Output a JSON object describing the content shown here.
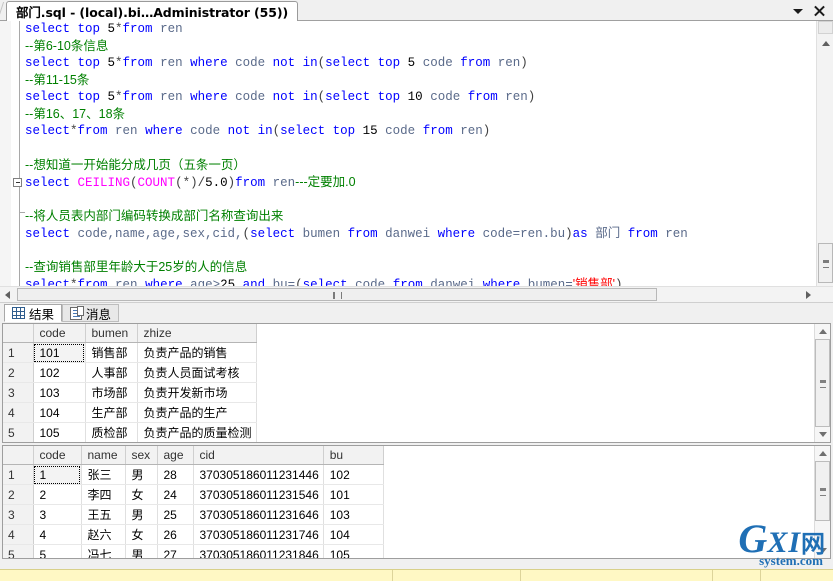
{
  "window": {
    "tab_title": "部门.sql - (local).bi…Administrator (55))",
    "dropdown_icon": "chevron-down-icon",
    "close_icon": "close-icon"
  },
  "editor": {
    "lines": [
      [
        {
          "t": "select top ",
          "c": "kw"
        },
        {
          "t": "5",
          "c": "num"
        },
        {
          "t": "*",
          "c": "pl"
        },
        {
          "t": "from ",
          "c": "kw"
        },
        {
          "t": "ren",
          "c": "id"
        }
      ],
      [
        {
          "t": "--第6-10条信息",
          "c": "cmt"
        }
      ],
      [
        {
          "t": "select top ",
          "c": "kw"
        },
        {
          "t": "5",
          "c": "num"
        },
        {
          "t": "*",
          "c": "pl"
        },
        {
          "t": "from ",
          "c": "kw"
        },
        {
          "t": "ren ",
          "c": "id"
        },
        {
          "t": "where ",
          "c": "kw"
        },
        {
          "t": "code ",
          "c": "id"
        },
        {
          "t": "not ",
          "c": "kw"
        },
        {
          "t": "in",
          "c": "kw"
        },
        {
          "t": "(",
          "c": "pl"
        },
        {
          "t": "select top ",
          "c": "kw"
        },
        {
          "t": "5 ",
          "c": "num"
        },
        {
          "t": "code ",
          "c": "id"
        },
        {
          "t": "from ",
          "c": "kw"
        },
        {
          "t": "ren",
          "c": "id"
        },
        {
          "t": ")",
          "c": "pl"
        }
      ],
      [
        {
          "t": "--第11-15条",
          "c": "cmt"
        }
      ],
      [
        {
          "t": "select top ",
          "c": "kw"
        },
        {
          "t": "5",
          "c": "num"
        },
        {
          "t": "*",
          "c": "pl"
        },
        {
          "t": "from ",
          "c": "kw"
        },
        {
          "t": "ren ",
          "c": "id"
        },
        {
          "t": "where ",
          "c": "kw"
        },
        {
          "t": "code ",
          "c": "id"
        },
        {
          "t": "not ",
          "c": "kw"
        },
        {
          "t": "in",
          "c": "kw"
        },
        {
          "t": "(",
          "c": "pl"
        },
        {
          "t": "select top ",
          "c": "kw"
        },
        {
          "t": "10 ",
          "c": "num"
        },
        {
          "t": "code ",
          "c": "id"
        },
        {
          "t": "from ",
          "c": "kw"
        },
        {
          "t": "ren",
          "c": "id"
        },
        {
          "t": ")",
          "c": "pl"
        }
      ],
      [
        {
          "t": "--第16、17、18条",
          "c": "cmt"
        }
      ],
      [
        {
          "t": "select",
          "c": "kw"
        },
        {
          "t": "*",
          "c": "pl"
        },
        {
          "t": "from ",
          "c": "kw"
        },
        {
          "t": "ren ",
          "c": "id"
        },
        {
          "t": "where ",
          "c": "kw"
        },
        {
          "t": "code ",
          "c": "id"
        },
        {
          "t": "not ",
          "c": "kw"
        },
        {
          "t": "in",
          "c": "kw"
        },
        {
          "t": "(",
          "c": "pl"
        },
        {
          "t": "select top ",
          "c": "kw"
        },
        {
          "t": "15 ",
          "c": "num"
        },
        {
          "t": "code ",
          "c": "id"
        },
        {
          "t": "from ",
          "c": "kw"
        },
        {
          "t": "ren",
          "c": "id"
        },
        {
          "t": ")",
          "c": "pl"
        }
      ],
      [],
      [
        {
          "t": "--想知道一开始能分成几页（五条一页）",
          "c": "cmt"
        }
      ],
      [
        {
          "t": "select ",
          "c": "kw"
        },
        {
          "t": "CEILING",
          "c": "fn"
        },
        {
          "t": "(",
          "c": "pl"
        },
        {
          "t": "COUNT",
          "c": "fn"
        },
        {
          "t": "(*)",
          "c": "pl"
        },
        {
          "t": "/",
          "c": "pl"
        },
        {
          "t": "5.0",
          "c": "num"
        },
        {
          "t": ")",
          "c": "pl"
        },
        {
          "t": "from ",
          "c": "kw"
        },
        {
          "t": "ren",
          "c": "id"
        },
        {
          "t": "---定要加.0",
          "c": "cmt"
        }
      ],
      [],
      [
        {
          "t": "--将人员表内部门编码转换成部门名称查询出来",
          "c": "cmt"
        }
      ],
      [
        {
          "t": "select ",
          "c": "kw"
        },
        {
          "t": "code,name,age,sex,cid,",
          "c": "id"
        },
        {
          "t": "(",
          "c": "pl"
        },
        {
          "t": "select ",
          "c": "kw"
        },
        {
          "t": "bumen ",
          "c": "id"
        },
        {
          "t": "from ",
          "c": "kw"
        },
        {
          "t": "danwei ",
          "c": "id"
        },
        {
          "t": "where ",
          "c": "kw"
        },
        {
          "t": "code=ren.bu",
          "c": "id"
        },
        {
          "t": ")",
          "c": "pl"
        },
        {
          "t": "as ",
          "c": "kw"
        },
        {
          "t": "部门",
          "c": "id cn"
        },
        {
          "t": " from ",
          "c": "kw"
        },
        {
          "t": "ren",
          "c": "id"
        }
      ],
      [],
      [
        {
          "t": "--查询销售部里年龄大于25岁的人的信息",
          "c": "cmt"
        }
      ],
      [
        {
          "t": "select",
          "c": "kw"
        },
        {
          "t": "*",
          "c": "pl"
        },
        {
          "t": "from ",
          "c": "kw"
        },
        {
          "t": "ren ",
          "c": "id"
        },
        {
          "t": "where ",
          "c": "kw"
        },
        {
          "t": "age>",
          "c": "id"
        },
        {
          "t": "25 ",
          "c": "num"
        },
        {
          "t": "and ",
          "c": "kw"
        },
        {
          "t": "bu=",
          "c": "id"
        },
        {
          "t": "(",
          "c": "pl"
        },
        {
          "t": "select ",
          "c": "kw"
        },
        {
          "t": "code ",
          "c": "id"
        },
        {
          "t": "from ",
          "c": "kw"
        },
        {
          "t": "danwei ",
          "c": "id"
        },
        {
          "t": "where ",
          "c": "kw"
        },
        {
          "t": "bumen=",
          "c": "id"
        },
        {
          "t": "'销售部'",
          "c": "str cn"
        },
        {
          "t": ")",
          "c": "pl"
        }
      ]
    ]
  },
  "results": {
    "tabs": [
      {
        "label": "结果",
        "icon": "grid-icon",
        "active": true
      },
      {
        "label": "消息",
        "icon": "message-icon",
        "active": false
      }
    ],
    "grid1": {
      "columns": [
        "",
        "code",
        "bumen",
        "zhize"
      ],
      "rows": [
        {
          "n": "1",
          "code": "101",
          "bumen": "销售部",
          "zhize": "负责产品的销售"
        },
        {
          "n": "2",
          "code": "102",
          "bumen": "人事部",
          "zhize": "负责人员面试考核"
        },
        {
          "n": "3",
          "code": "103",
          "bumen": "市场部",
          "zhize": "负责开发新市场"
        },
        {
          "n": "4",
          "code": "104",
          "bumen": "生产部",
          "zhize": "负责产品的生产"
        },
        {
          "n": "5",
          "code": "105",
          "bumen": "质检部",
          "zhize": "负责产品的质量检测"
        }
      ]
    },
    "grid2": {
      "columns": [
        "",
        "code",
        "name",
        "sex",
        "age",
        "cid",
        "bu"
      ],
      "rows": [
        {
          "n": "1",
          "code": "1",
          "name": "张三",
          "sex": "男",
          "age": "28",
          "cid": "370305186011231446",
          "bu": "102"
        },
        {
          "n": "2",
          "code": "2",
          "name": "李四",
          "sex": "女",
          "age": "24",
          "cid": "370305186011231546",
          "bu": "101"
        },
        {
          "n": "3",
          "code": "3",
          "name": "王五",
          "sex": "男",
          "age": "25",
          "cid": "370305186011231646",
          "bu": "103"
        },
        {
          "n": "4",
          "code": "4",
          "name": "赵六",
          "sex": "女",
          "age": "26",
          "cid": "370305186011231746",
          "bu": "104"
        },
        {
          "n": "5",
          "code": "5",
          "name": "冯七",
          "sex": "男",
          "age": "27",
          "cid": "370305186011231846",
          "bu": "105"
        }
      ]
    }
  },
  "watermark": {
    "g": "G",
    "xi": "XI",
    "net": "网",
    "sub": "system.com"
  },
  "colors": {
    "keyword": "#0000FF",
    "comment": "#008000",
    "function": "#FF00FF",
    "string": "#FF0000",
    "identifier": "#5A6A8A",
    "statusbar": "#FFF8C4",
    "watermark": "#1F6FB5"
  }
}
